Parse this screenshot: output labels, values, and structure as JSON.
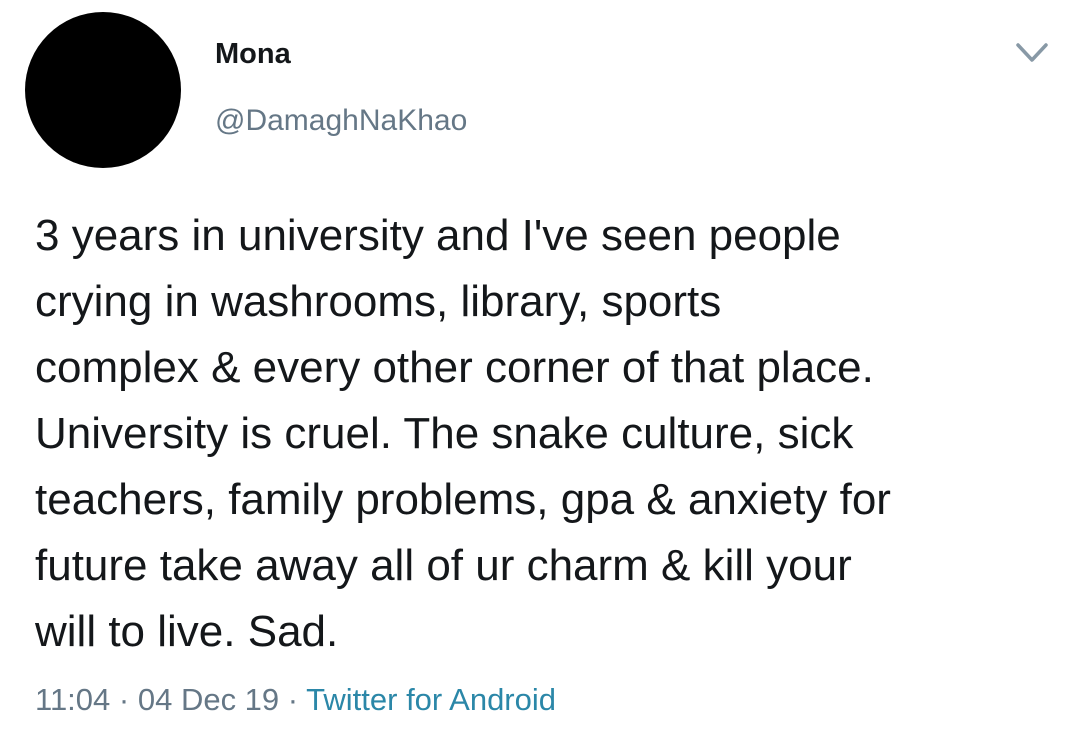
{
  "user": {
    "name": "Mona",
    "handle": "@DamaghNaKhao"
  },
  "tweet": {
    "lines": [
      "3 years in university and I've seen people",
      "crying in washrooms, library, sports",
      "complex & every other corner of that place.",
      "University is cruel. The snake culture, sick",
      "teachers, family problems, gpa & anxiety for",
      "future take away all of ur charm & kill your",
      "will to live. Sad."
    ]
  },
  "footer": {
    "time": "11:04",
    "sep1": " · ",
    "date": "04 Dec 19",
    "sep2": " · ",
    "source": "Twitter for Android"
  },
  "colors": {
    "text": "#14171a",
    "secondary": "#657786",
    "link": "#2b87a8"
  }
}
